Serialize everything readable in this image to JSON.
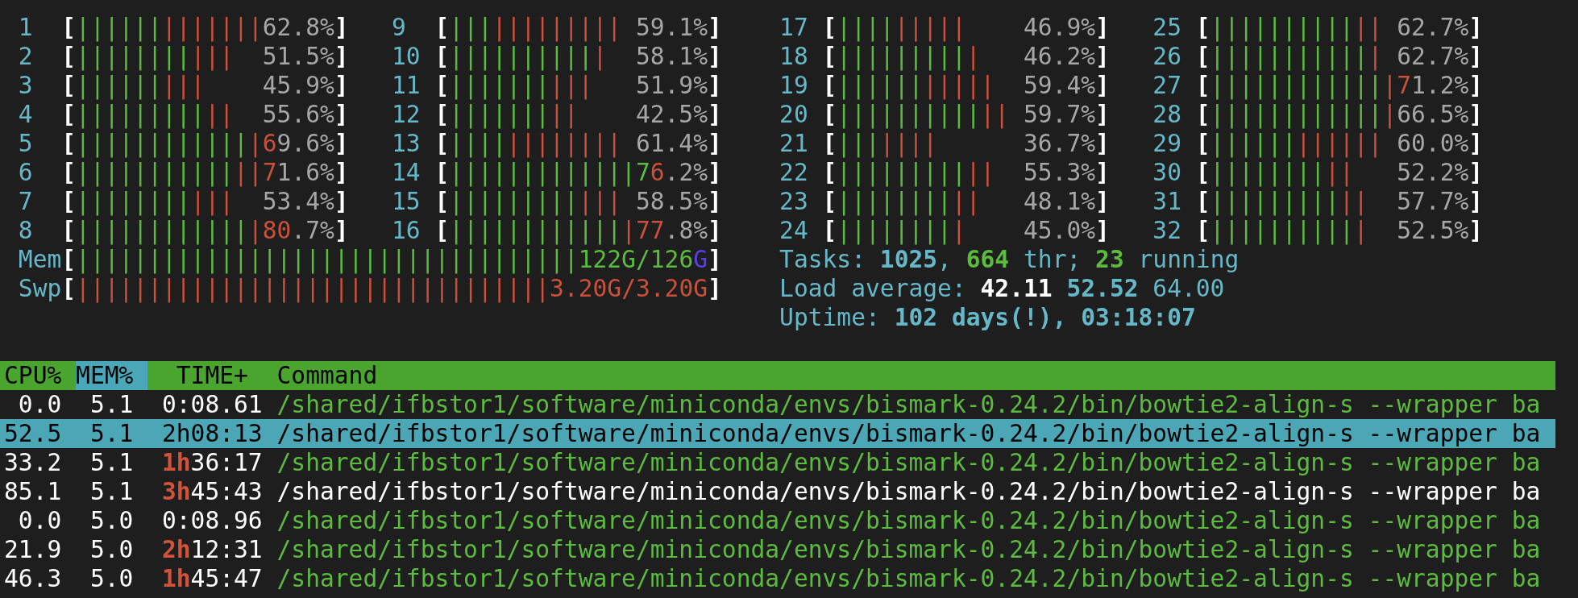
{
  "cpu_meters": [
    {
      "label": "1",
      "open": "[",
      "segments": [
        {
          "text": "||||||",
          "color": "#5cbb3f"
        },
        {
          "text": "|||||||",
          "color": "#c9503a"
        }
      ],
      "reading": [
        {
          "text": "62.8%"
        }
      ],
      "close": "]"
    },
    {
      "label": "2",
      "open": "[",
      "segments": [
        {
          "text": "||||||||",
          "color": "#5cbb3f"
        },
        {
          "text": "|||",
          "color": "#c9503a"
        }
      ],
      "reading": [
        {
          "text": "51.5%"
        }
      ],
      "close": "]"
    },
    {
      "label": "3",
      "open": "[",
      "segments": [
        {
          "text": "||||||",
          "color": "#5cbb3f"
        },
        {
          "text": "|||",
          "color": "#c9503a"
        }
      ],
      "reading": [
        {
          "text": "45.9%"
        }
      ],
      "close": "]"
    },
    {
      "label": "4",
      "open": "[",
      "segments": [
        {
          "text": "|||||||||",
          "color": "#5cbb3f"
        },
        {
          "text": "||",
          "color": "#c9503a"
        }
      ],
      "reading": [
        {
          "text": "55.6%"
        }
      ],
      "close": "]"
    },
    {
      "label": "5",
      "open": "[",
      "segments": [
        {
          "text": "||||||||||||",
          "color": "#5cbb3f"
        },
        {
          "text": "|",
          "color": "#c9503a"
        }
      ],
      "reading": [
        {
          "text": "6",
          "color": "#c9503a"
        },
        {
          "text": "9.6%"
        }
      ],
      "close": "]"
    },
    {
      "label": "6",
      "open": "[",
      "segments": [
        {
          "text": "|||||||||||",
          "color": "#5cbb3f"
        },
        {
          "text": "||",
          "color": "#c9503a"
        }
      ],
      "reading": [
        {
          "text": "7",
          "color": "#c9503a"
        },
        {
          "text": "1.6%"
        }
      ],
      "close": "]"
    },
    {
      "label": "7",
      "open": "[",
      "segments": [
        {
          "text": "||||||||",
          "color": "#5cbb3f"
        },
        {
          "text": "|||",
          "color": "#c9503a"
        }
      ],
      "reading": [
        {
          "text": "53.4%"
        }
      ],
      "close": "]"
    },
    {
      "label": "8",
      "open": "[",
      "segments": [
        {
          "text": "||||||||||||",
          "color": "#5cbb3f"
        },
        {
          "text": "|",
          "color": "#c9503a"
        }
      ],
      "reading": [
        {
          "text": "80",
          "color": "#c9503a"
        },
        {
          "text": ".7%"
        }
      ],
      "close": "]"
    },
    {
      "label": "9",
      "open": "[",
      "segments": [
        {
          "text": "|||",
          "color": "#5cbb3f"
        },
        {
          "text": "|||||||||",
          "color": "#c9503a"
        }
      ],
      "reading": [
        {
          "text": "59.1%"
        }
      ],
      "close": "]"
    },
    {
      "label": "10",
      "open": "[",
      "segments": [
        {
          "text": "||||||||||",
          "color": "#5cbb3f"
        },
        {
          "text": "|",
          "color": "#c9503a"
        }
      ],
      "reading": [
        {
          "text": "58.1%"
        }
      ],
      "close": "]"
    },
    {
      "label": "11",
      "open": "[",
      "segments": [
        {
          "text": "|||||||",
          "color": "#5cbb3f"
        },
        {
          "text": "|||",
          "color": "#c9503a"
        }
      ],
      "reading": [
        {
          "text": "51.9%"
        }
      ],
      "close": "]"
    },
    {
      "label": "12",
      "open": "[",
      "segments": [
        {
          "text": "|||||||",
          "color": "#5cbb3f"
        },
        {
          "text": "||",
          "color": "#c9503a"
        }
      ],
      "reading": [
        {
          "text": "42.5%"
        }
      ],
      "close": "]"
    },
    {
      "label": "13",
      "open": "[",
      "segments": [
        {
          "text": "||||",
          "color": "#5cbb3f"
        },
        {
          "text": "||||||||",
          "color": "#c9503a"
        }
      ],
      "reading": [
        {
          "text": "61.4%"
        }
      ],
      "close": "]"
    },
    {
      "label": "14",
      "open": "[",
      "segments": [
        {
          "text": "|||||||||||||",
          "color": "#5cbb3f"
        }
      ],
      "reading": [
        {
          "text": "7",
          "color": "#5cbb3f"
        },
        {
          "text": "6",
          "color": "#c9503a"
        },
        {
          "text": ".2%"
        }
      ],
      "close": "]"
    },
    {
      "label": "15",
      "open": "[",
      "segments": [
        {
          "text": "|||||||||",
          "color": "#5cbb3f"
        },
        {
          "text": "|||",
          "color": "#c9503a"
        }
      ],
      "reading": [
        {
          "text": "58.5%"
        }
      ],
      "close": "]"
    },
    {
      "label": "16",
      "open": "[",
      "segments": [
        {
          "text": "||||||||||||",
          "color": "#5cbb3f"
        },
        {
          "text": "|",
          "color": "#c9503a"
        }
      ],
      "reading": [
        {
          "text": "77",
          "color": "#c9503a"
        },
        {
          "text": ".8%"
        }
      ],
      "close": "]"
    },
    {
      "label": "17",
      "open": "[",
      "segments": [
        {
          "text": "||||",
          "color": "#5cbb3f"
        },
        {
          "text": "|||||",
          "color": "#c9503a"
        }
      ],
      "reading": [
        {
          "text": "46.9%"
        }
      ],
      "close": "]"
    },
    {
      "label": "18",
      "open": "[",
      "segments": [
        {
          "text": "|||||||||",
          "color": "#5cbb3f"
        },
        {
          "text": "|",
          "color": "#c9503a"
        }
      ],
      "reading": [
        {
          "text": "46.2%"
        }
      ],
      "close": "]"
    },
    {
      "label": "19",
      "open": "[",
      "segments": [
        {
          "text": "||||||",
          "color": "#5cbb3f"
        },
        {
          "text": "|||||",
          "color": "#c9503a"
        }
      ],
      "reading": [
        {
          "text": "59.4%"
        }
      ],
      "close": "]"
    },
    {
      "label": "20",
      "open": "[",
      "segments": [
        {
          "text": "||||||||||",
          "color": "#5cbb3f"
        },
        {
          "text": "||",
          "color": "#c9503a"
        }
      ],
      "reading": [
        {
          "text": "59.7%"
        }
      ],
      "close": "]"
    },
    {
      "label": "21",
      "open": "[",
      "segments": [
        {
          "text": "|||",
          "color": "#5cbb3f"
        },
        {
          "text": "||||",
          "color": "#c9503a"
        }
      ],
      "reading": [
        {
          "text": "36.7%"
        }
      ],
      "close": "]"
    },
    {
      "label": "22",
      "open": "[",
      "segments": [
        {
          "text": "|||||||||",
          "color": "#5cbb3f"
        },
        {
          "text": "||",
          "color": "#c9503a"
        }
      ],
      "reading": [
        {
          "text": "55.3%"
        }
      ],
      "close": "]"
    },
    {
      "label": "23",
      "open": "[",
      "segments": [
        {
          "text": "||||||||",
          "color": "#5cbb3f"
        },
        {
          "text": "||",
          "color": "#c9503a"
        }
      ],
      "reading": [
        {
          "text": "48.1%"
        }
      ],
      "close": "]"
    },
    {
      "label": "24",
      "open": "[",
      "segments": [
        {
          "text": "||||||||",
          "color": "#5cbb3f"
        },
        {
          "text": "|",
          "color": "#c9503a"
        }
      ],
      "reading": [
        {
          "text": "45.0%"
        }
      ],
      "close": "]"
    },
    {
      "label": "25",
      "open": "[",
      "segments": [
        {
          "text": "||||||||||",
          "color": "#5cbb3f"
        },
        {
          "text": "||",
          "color": "#c9503a"
        }
      ],
      "reading": [
        {
          "text": "62.7%"
        }
      ],
      "close": "]"
    },
    {
      "label": "26",
      "open": "[",
      "segments": [
        {
          "text": "|||||||||||",
          "color": "#5cbb3f"
        },
        {
          "text": "|",
          "color": "#c9503a"
        }
      ],
      "reading": [
        {
          "text": "62.7%"
        }
      ],
      "close": "]"
    },
    {
      "label": "27",
      "open": "[",
      "segments": [
        {
          "text": "||||||||||||",
          "color": "#5cbb3f"
        },
        {
          "text": "|",
          "color": "#c9503a"
        }
      ],
      "reading": [
        {
          "text": "7",
          "color": "#c9503a"
        },
        {
          "text": "1.2%"
        }
      ],
      "close": "]"
    },
    {
      "label": "28",
      "open": "[",
      "segments": [
        {
          "text": "||||||||||||",
          "color": "#5cbb3f"
        },
        {
          "text": "|",
          "color": "#c9503a"
        }
      ],
      "reading": [
        {
          "text": "66.5%"
        }
      ],
      "close": "]"
    },
    {
      "label": "29",
      "open": "[",
      "segments": [
        {
          "text": "||||||",
          "color": "#5cbb3f"
        },
        {
          "text": "||||||",
          "color": "#c9503a"
        }
      ],
      "reading": [
        {
          "text": "60.0%"
        }
      ],
      "close": "]"
    },
    {
      "label": "30",
      "open": "[",
      "segments": [
        {
          "text": "||||||||",
          "color": "#5cbb3f"
        },
        {
          "text": "||",
          "color": "#c9503a"
        }
      ],
      "reading": [
        {
          "text": "52.2%"
        }
      ],
      "close": "]"
    },
    {
      "label": "31",
      "open": "[",
      "segments": [
        {
          "text": "|||||||||",
          "color": "#5cbb3f"
        },
        {
          "text": "||",
          "color": "#c9503a"
        }
      ],
      "reading": [
        {
          "text": "57.7%"
        }
      ],
      "close": "]"
    },
    {
      "label": "32",
      "open": "[",
      "segments": [
        {
          "text": "||||||||||",
          "color": "#5cbb3f"
        },
        {
          "text": "|",
          "color": "#c9503a"
        }
      ],
      "reading": [
        {
          "text": "52.5%"
        }
      ],
      "close": "]"
    }
  ],
  "memory_meters": [
    {
      "label": "Mem",
      "open": "[",
      "segments": [
        {
          "text": "|||||||||||||||||||||||||||||||||||",
          "color": "#5cbb3f"
        }
      ],
      "reading": [
        {
          "text": "122G/126",
          "color": "#5cbb3f"
        },
        {
          "text": "G",
          "color": "#5b3ee6"
        }
      ],
      "close": "]"
    },
    {
      "label": "Swp",
      "open": "[",
      "segments": [
        {
          "text": "|||||||||||||||||||||||||||||||||",
          "color": "#c9503a"
        }
      ],
      "reading": [
        {
          "text": "3.20G/3.20G",
          "color": "#c9503a"
        }
      ],
      "close": "]"
    }
  ],
  "summary": [
    {
      "parts": [
        {
          "text": "Tasks: ",
          "kind": "label"
        },
        {
          "text": "1025",
          "kind": "value"
        },
        {
          "text": ", ",
          "kind": "label"
        },
        {
          "text": "664",
          "kind": "count"
        },
        {
          "text": " thr; ",
          "kind": "label"
        },
        {
          "text": "23",
          "kind": "count"
        },
        {
          "text": " running",
          "kind": "label"
        }
      ]
    },
    {
      "parts": [
        {
          "text": "Load average: ",
          "kind": "label"
        },
        {
          "text": "42.11 ",
          "kind": "peak"
        },
        {
          "text": "52.52 ",
          "kind": "value"
        },
        {
          "text": "64.00",
          "kind": "label"
        }
      ]
    },
    {
      "parts": [
        {
          "text": "Uptime: ",
          "kind": "label"
        },
        {
          "text": "102 days(!), 03:18:07",
          "kind": "value"
        }
      ]
    }
  ],
  "table": {
    "columns": [
      {
        "label": "CPU%",
        "selected": false
      },
      {
        "label": "MEM%",
        "selected": true
      },
      {
        "label": "TIME+",
        "selected": false
      },
      {
        "label": "Command",
        "selected": false
      }
    ],
    "rows": [
      {
        "cpu": "0.0",
        "mem": "5.1",
        "time": [
          {
            "text": "0:08.61",
            "kind": "plain"
          }
        ],
        "command": "/shared/ifbstor1/software/miniconda/envs/bismark-0.24.2/bin/bowtie2-align-s --wrapper ba",
        "thread": true,
        "selected": false
      },
      {
        "cpu": "52.5",
        "mem": "5.1",
        "time": [
          {
            "text": "2h",
            "kind": "hours"
          },
          {
            "text": "08:13",
            "kind": "plain"
          }
        ],
        "command": "/shared/ifbstor1/software/miniconda/envs/bismark-0.24.2/bin/bowtie2-align-s --wrapper ba",
        "thread": true,
        "selected": true
      },
      {
        "cpu": "33.2",
        "mem": "5.1",
        "time": [
          {
            "text": "1h",
            "kind": "hours"
          },
          {
            "text": "36:17",
            "kind": "plain"
          }
        ],
        "command": "/shared/ifbstor1/software/miniconda/envs/bismark-0.24.2/bin/bowtie2-align-s --wrapper ba",
        "thread": true,
        "selected": false
      },
      {
        "cpu": "85.1",
        "mem": "5.1",
        "time": [
          {
            "text": "3h",
            "kind": "hours"
          },
          {
            "text": "45:43",
            "kind": "plain"
          }
        ],
        "command": "/shared/ifbstor1/software/miniconda/envs/bismark-0.24.2/bin/bowtie2-align-s --wrapper ba",
        "thread": false,
        "selected": false
      },
      {
        "cpu": "0.0",
        "mem": "5.0",
        "time": [
          {
            "text": "0:08.96",
            "kind": "plain"
          }
        ],
        "command": "/shared/ifbstor1/software/miniconda/envs/bismark-0.24.2/bin/bowtie2-align-s --wrapper ba",
        "thread": true,
        "selected": false
      },
      {
        "cpu": "21.9",
        "mem": "5.0",
        "time": [
          {
            "text": "2h",
            "kind": "hours"
          },
          {
            "text": "12:31",
            "kind": "plain"
          }
        ],
        "command": "/shared/ifbstor1/software/miniconda/envs/bismark-0.24.2/bin/bowtie2-align-s --wrapper ba",
        "thread": true,
        "selected": false
      },
      {
        "cpu": "46.3",
        "mem": "5.0",
        "time": [
          {
            "text": "1h",
            "kind": "hours"
          },
          {
            "text": "45:47",
            "kind": "plain"
          }
        ],
        "command": "/shared/ifbstor1/software/miniconda/envs/bismark-0.24.2/bin/bowtie2-align-s --wrapper ba",
        "thread": true,
        "selected": false
      }
    ]
  }
}
